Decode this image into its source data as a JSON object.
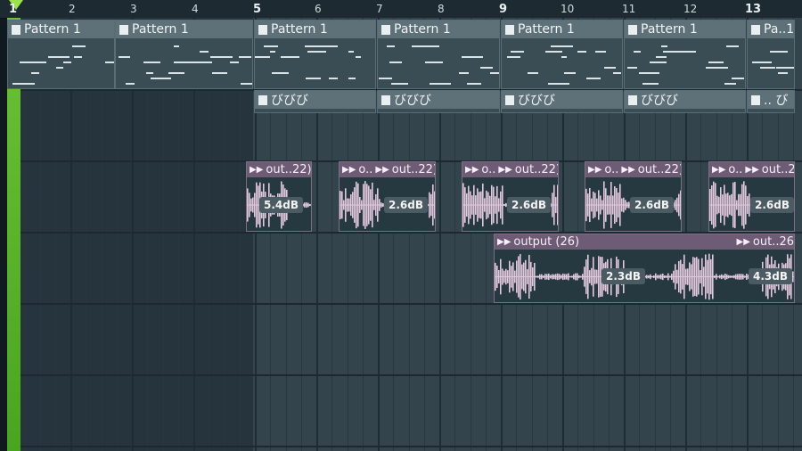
{
  "ruler": {
    "bars": [
      "1",
      "2",
      "3",
      "4",
      "5",
      "6",
      "7",
      "8",
      "9",
      "10",
      "11",
      "12",
      "13"
    ]
  },
  "pattern_row": {
    "label": "Pattern 1",
    "truncated_label": "Pa..1"
  },
  "automation_row": {
    "label": "びびび",
    "truncated_label": ".. び"
  },
  "audio_row_1": {
    "clip_label": "out..22)",
    "short_label": "o..",
    "truncated_label": "out..22",
    "db_values": [
      "5.4dB",
      "2.6dB",
      "2.6dB",
      "2.6dB",
      "2.6dB"
    ]
  },
  "audio_row_2": {
    "clip_label": "output (26)",
    "truncated_label": "out..26",
    "db_values": [
      "2.3dB",
      "4.3dB"
    ]
  },
  "colors": {
    "grid_bg": "#33444d",
    "pattern_header": "#5e7078",
    "audio_header": "#6e5b75",
    "waveform": "#e2c9dc",
    "playhead": "#9be34a"
  }
}
